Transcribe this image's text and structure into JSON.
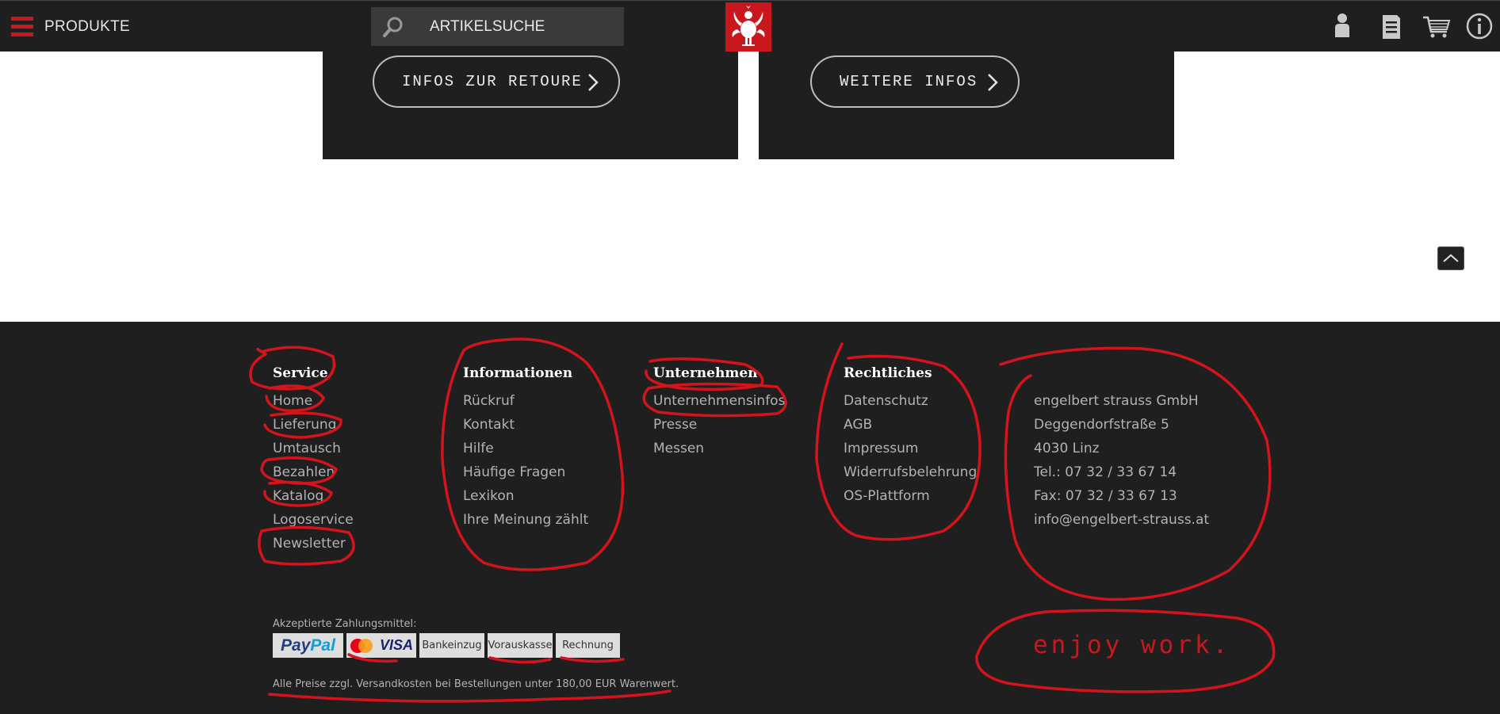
{
  "header": {
    "menu_label": "PRODUKTE",
    "search_placeholder": "ARTIKELSUCHE",
    "brand_color": "#c8181e",
    "icons": [
      "user-icon",
      "catalog-icon",
      "cart-icon",
      "info-icon"
    ]
  },
  "teasers": {
    "left_button": "INFOS ZUR RETOURE",
    "right_button": "WEITERE INFOS"
  },
  "footer": {
    "service": {
      "title": "Service",
      "items": [
        "Home",
        "Lieferung",
        "Umtausch",
        "Bezahlen",
        "Katalog",
        "Logoservice",
        "Newsletter"
      ]
    },
    "informationen": {
      "title": "Informationen",
      "items": [
        "Rückruf",
        "Kontakt",
        "Hilfe",
        "Häufige Fragen",
        "Lexikon",
        "Ihre Meinung zählt"
      ]
    },
    "unternehmen": {
      "title": "Unternehmen",
      "items": [
        "Unternehmensinfos",
        "Presse",
        "Messen"
      ]
    },
    "rechtliches": {
      "title": "Rechtliches",
      "items": [
        "Datenschutz",
        "AGB",
        "Impressum",
        "Widerrufsbelehrung",
        "OS-Plattform"
      ]
    },
    "address": [
      "engelbert strauss GmbH",
      "Deggendorfstraße 5",
      "4030 Linz",
      "Tel.: 07 32 / 33 67 14",
      "Fax: 07 32 / 33 67 13",
      "info@engelbert-strauss.at"
    ],
    "payment_label": "Akzeptierte Zahlungsmittel:",
    "payment_methods": {
      "paypal_pay": "Pay",
      "paypal_pal": "Pal",
      "visa": "VISA",
      "bankeinzug": "Bankeinzug",
      "vorauskasse": "Vorauskasse",
      "rechnung": "Rechnung"
    },
    "price_note": "Alle Preise zzgl. Versandkosten bei Bestellungen unter 180,00 EUR Warenwert.",
    "slogan": "enjoy work."
  }
}
